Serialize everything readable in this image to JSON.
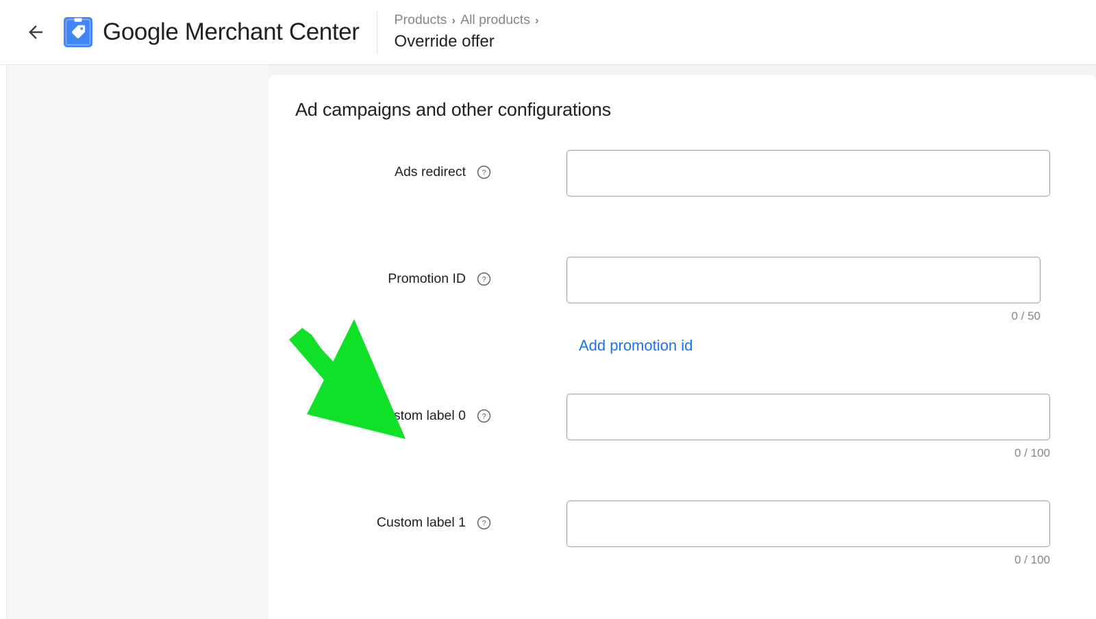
{
  "header": {
    "back_icon": "arrow-left-icon",
    "logo_icon": "merchant-center-tag-logo",
    "brand_bold": "Google",
    "brand_light": " Merchant Center",
    "breadcrumb": [
      {
        "label": "Products",
        "sep": "›"
      },
      {
        "label": "All products",
        "sep": "›"
      }
    ],
    "page_title": "Override offer"
  },
  "card": {
    "section_title": "Ad campaigns and other configurations"
  },
  "form": {
    "rows": [
      {
        "name": "ads-redirect",
        "label": "Ads redirect",
        "help_icon": "help-circle-icon",
        "value": "",
        "placeholder": "",
        "counter": "",
        "field_width": 706
      },
      {
        "name": "promotion-id",
        "label": "Promotion ID",
        "help_icon": "help-circle-icon",
        "value": "",
        "placeholder": "",
        "counter": "0 / 50",
        "field_width": 692
      },
      {
        "name": "custom-label-0",
        "label": "Custom label 0",
        "help_icon": "help-circle-icon",
        "value": "",
        "placeholder": "",
        "counter": "0 / 100",
        "field_width": 706
      },
      {
        "name": "custom-label-1",
        "label": "Custom label 1",
        "help_icon": "help-circle-icon",
        "value": "",
        "placeholder": "",
        "counter": "0 / 100",
        "field_width": 706
      }
    ],
    "add_promotion_link": "Add promotion id"
  },
  "annotation": {
    "arrow_color": "#10E028",
    "arrow_name": "green-annotation-arrow"
  },
  "colors": {
    "accent_blue": "#1a73e8",
    "logo_blue": "#4285f4",
    "text_primary": "#202124",
    "text_secondary": "#80868b",
    "page_bg": "#f1f3f4",
    "card_bg": "#ffffff",
    "field_border": "#9aa0a6"
  }
}
